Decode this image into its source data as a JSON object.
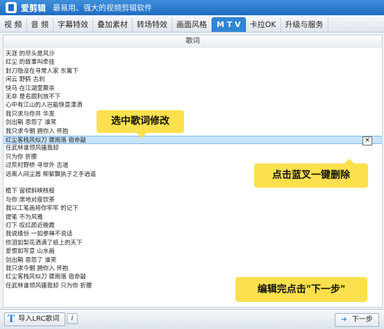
{
  "app": {
    "name": "爱剪辑",
    "subtitle": "最易用、强大的视频剪辑软件"
  },
  "tabs": [
    {
      "label": "视  频"
    },
    {
      "label": "音  频"
    },
    {
      "label": "字幕特效"
    },
    {
      "label": "叠加素材"
    },
    {
      "label": "转场特效"
    },
    {
      "label": "画面风格"
    },
    {
      "label": "M T V",
      "active": true
    },
    {
      "label": "卡拉OK"
    },
    {
      "label": "升级与服务"
    }
  ],
  "lyrics_header": "歌词",
  "lyrics": [
    "天涯 的尽头是风沙",
    "红尘 的故事叫牵挂",
    "封刀隐没在寻常人家 东篱下",
    "闲云 野鹤 古刹",
    "快马 在江湖里厮杀",
    "无非 是名跟利放不下",
    "心中有江山的人岂能快意潇洒",
    "我只求与你共 华发",
    "剑出鞘 恩怨了 谁笑",
    "我只求今朝 拥你入 怀抱",
    "红尘客栈风似刀 骤雨落 宿命敲",
    "任武林谁领风骚我却",
    "只为你 折腰",
    "过荒村野桥 寻世外 古道",
    "远离人间尘嚣 柳絮飘执子之手逍遥",
    "",
    "檐下 窗棂斜映枝桠",
    "与你 席地对座饮茶",
    "我以工笔画将你牢牢 的记下",
    "提笔 不为风雅",
    "灯下 叹红颜近晚霞",
    "我说缘份 一如参禅不说话",
    "你泪如梨花洒满了纸上的天下",
    "爱恨如写意 山水画",
    "剑出鞘 恩怨了 谁笑",
    "我只求今朝 拥你入 怀抱",
    "红尘客栈风似刀 骤雨落 宿命敲",
    "任武林谁领风骚我却 只为你 折腰"
  ],
  "selected_index": 10,
  "delete_label": "✕",
  "callouts": {
    "select": "选中歌词修改",
    "delete": "点击蓝叉一键删除",
    "next": "编辑完点击\"下一步\""
  },
  "bottom": {
    "import_icon": "T",
    "import_label": "导入LRC歌词",
    "info_label": "i",
    "next_arrow": "➜",
    "next_label": "下一步"
  },
  "colors": {
    "accent": "#2f86d6",
    "callout": "#fbe04d",
    "selected_row": "#c9e4fb"
  }
}
